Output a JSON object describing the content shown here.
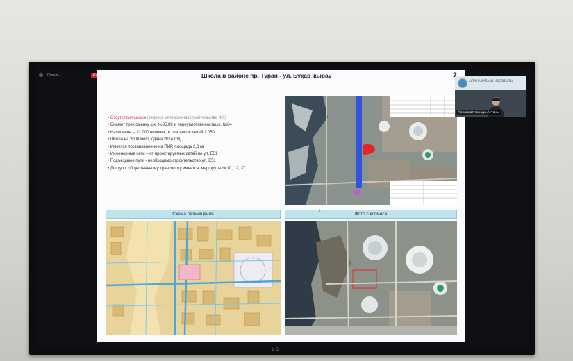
{
  "toolbar": {
    "search_text": "Поиск...",
    "live_badge": "LIVE",
    "button_label": "Facebook"
  },
  "slide": {
    "title": "Школа в районе пр. Туран - ул. Бұқар жырау",
    "page_number": "2",
    "bullets": [
      {
        "main": "Отсутствуетшкола",
        "note": " (ведется интенсивнаястройтельство ЖК)"
      },
      {
        "main": "Снимет трех сменку шк. №85,89 и переуплотнённостьшк. №84",
        "note": ""
      },
      {
        "main": "Население – 12 000 человек, в том числе детей 2 050",
        "note": ""
      },
      {
        "main": "Школа на 2000 мест, сдача 2024 год",
        "note": ""
      },
      {
        "main": "Имеется постановление на ПИР, площадь 2,8 га",
        "note": ""
      },
      {
        "main": "Инженерные сети – от проектируемых сетей по ул. Е51",
        "note": ""
      },
      {
        "main": "Подъездные пути - необходимо строительство ул. Е51",
        "note": ""
      },
      {
        "main": "Доступ к общественному транспорту имеется, маршруты №10, 12, 37",
        "note": ""
      }
    ],
    "left_caption": "Схема размещения",
    "right_caption": "Фото с космоса"
  },
  "camera": {
    "label": "Маслихат города Астаны",
    "sign_text": "АСТАНА ҚАЛАСЫ МӘСЛИХАТЫ"
  },
  "tv": {
    "brand": "LG"
  },
  "colors": {
    "road_highlight": "#2f55e0",
    "site_marker": "#e0262a",
    "caption_bar": "#bfe3ea"
  }
}
